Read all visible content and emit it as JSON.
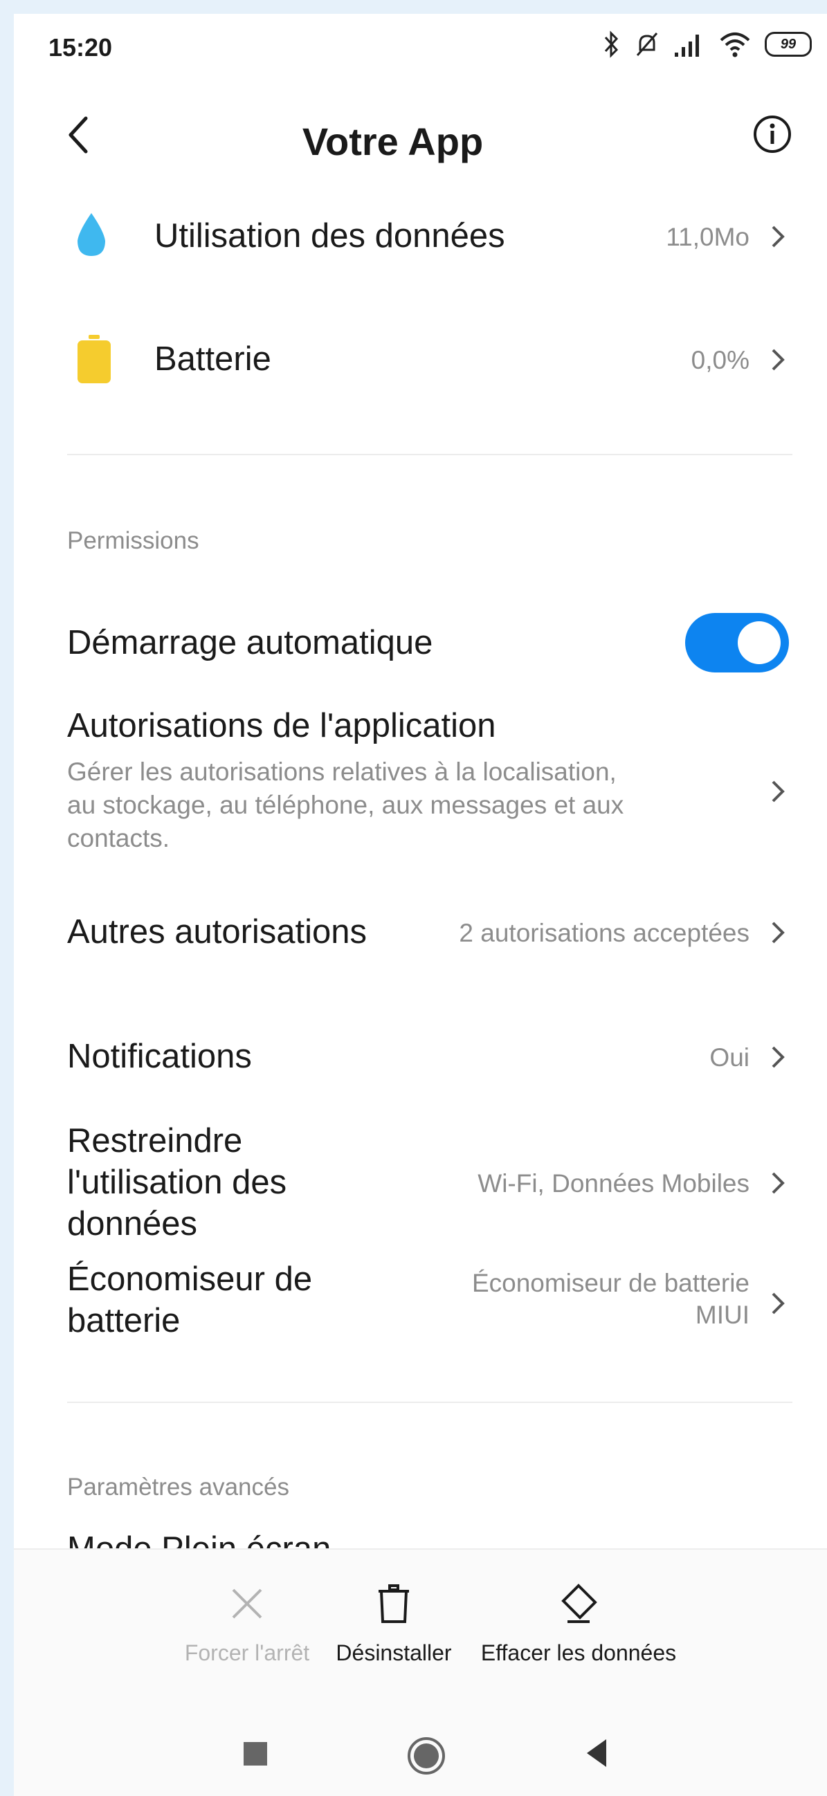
{
  "status_bar": {
    "time": "15:20",
    "battery": "99"
  },
  "header": {
    "title": "Votre App"
  },
  "usage": {
    "data_label": "Utilisation des données",
    "data_value": "11,0Mo",
    "battery_label": "Batterie",
    "battery_value": "0,0%"
  },
  "permissions": {
    "section_title": "Permissions",
    "autostart_label": "Démarrage automatique",
    "autostart_on": true,
    "app_perms_label": "Autorisations de l'application",
    "app_perms_desc_1": "Gérer les autorisations relatives à la localisation,",
    "app_perms_desc_2": "au stockage, au téléphone, aux messages et aux",
    "app_perms_desc_3": "contacts.",
    "other_perms_label": "Autres autorisations",
    "other_perms_value": "2 autorisations acceptées",
    "notifications_label": "Notifications",
    "notifications_value": "Oui",
    "restrict_label_1": "Restreindre",
    "restrict_label_2": "l'utilisation des",
    "restrict_label_3": "données",
    "restrict_value": "Wi-Fi, Données Mobiles",
    "saver_label_1": "Économiseur de",
    "saver_label_2": "batterie",
    "saver_value_1": "Économiseur de batterie",
    "saver_value_2": "MIUI"
  },
  "advanced": {
    "section_title": "Paramètres avancés",
    "fullscreen_label": "Mode Plein écran"
  },
  "actions": {
    "force_stop": "Forcer l'arrêt",
    "uninstall": "Désinstaller",
    "clear_data": "Effacer les données"
  },
  "colors": {
    "accent": "#0d84f0",
    "data_icon": "#3fb8ef",
    "battery_icon": "#f5cc2e",
    "secondary_text": "#8c8c8c"
  }
}
